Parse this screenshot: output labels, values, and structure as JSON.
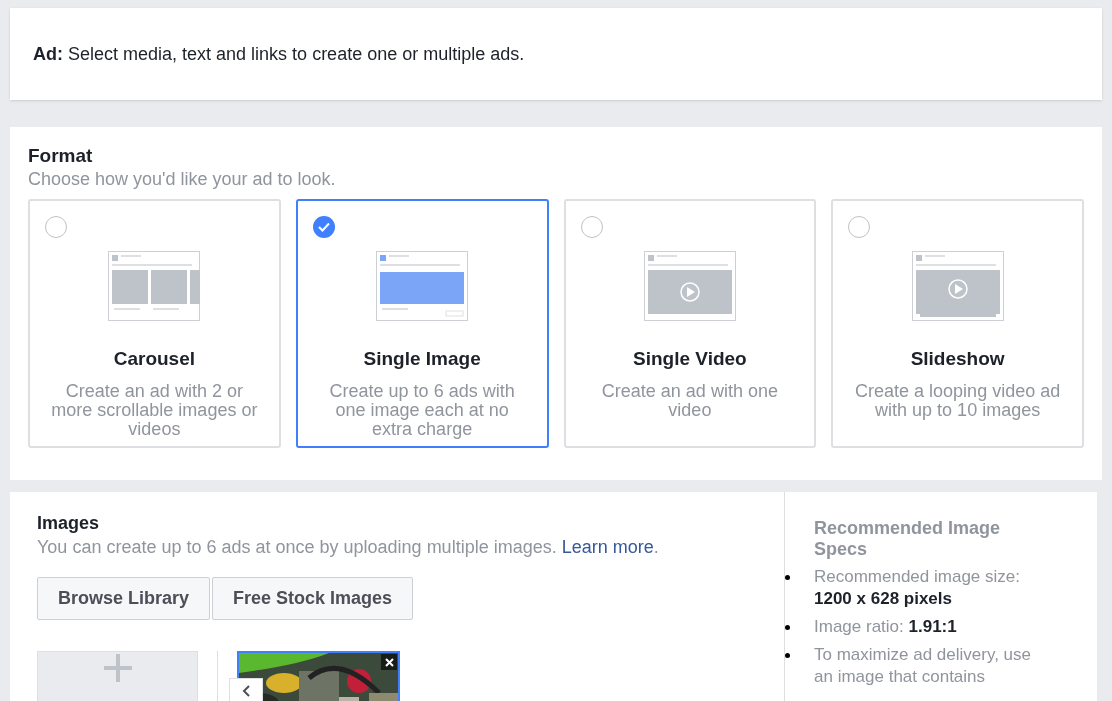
{
  "ad_header": {
    "label": "Ad:",
    "text": "Select media, text and links to create one or multiple ads."
  },
  "format": {
    "title": "Format",
    "subtitle": "Choose how you'd like your ad to look.",
    "options": [
      {
        "kind": "carousel",
        "title": "Carousel",
        "description": "Create an ad with 2 or more scrollable images or videos",
        "selected": false
      },
      {
        "kind": "single_image",
        "title": "Single Image",
        "description": "Create up to 6 ads with one image each at no extra charge",
        "selected": true
      },
      {
        "kind": "video",
        "title": "Single Video",
        "description": "Create an ad with one video",
        "selected": false
      },
      {
        "kind": "slideshow",
        "title": "Slideshow",
        "description": "Create a looping video ad with up to 10 images",
        "selected": false
      }
    ]
  },
  "images": {
    "title": "Images",
    "subtitle": "You can create up to 6 ads at once by uploading multiple images.",
    "link": "Learn more",
    "link_suffix": ".",
    "buttons": [
      "Browse Library",
      "Free Stock Images"
    ],
    "thumbnails": [
      {
        "kind": "picture",
        "selected": true
      }
    ]
  },
  "specs": {
    "title": "Recommended Image Specs",
    "items": [
      "Recommended image size: **1200 x 628 pixels**",
      "Image ratio: **1.91:1**",
      "To maximize ad delivery, use an image that contains"
    ]
  }
}
